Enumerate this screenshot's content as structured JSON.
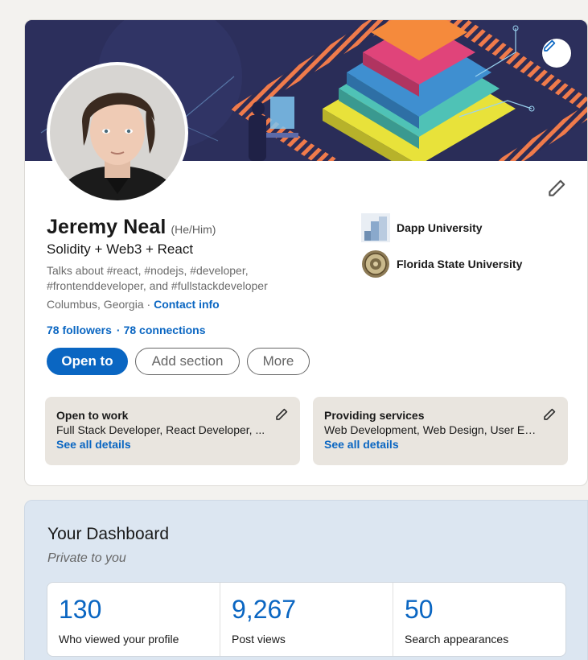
{
  "profile": {
    "name": "Jeremy Neal",
    "pronouns": "(He/Him)",
    "headline": "Solidity + Web3 + React",
    "talks_about": "Talks about #react, #nodejs, #developer, #frontenddeveloper, and #fullstackdeveloper",
    "location": "Columbus, Georgia",
    "location_separator": " · ",
    "contact_info": "Contact info",
    "followers": "78 followers",
    "connections": "78 connections",
    "connections_separator": "·"
  },
  "actions": {
    "open_to": "Open to",
    "add_section": "Add section",
    "more": "More"
  },
  "education": [
    {
      "name": "Dapp University",
      "icon": "dapp-university-logo"
    },
    {
      "name": "Florida State University",
      "icon": "fsu-seal-logo"
    }
  ],
  "info_boxes": [
    {
      "title": "Open to work",
      "subtitle": "Full Stack Developer, React Developer, ...",
      "link": "See all details"
    },
    {
      "title": "Providing services",
      "subtitle": "Web Development, Web Design, User Experience Design (UED)...",
      "link": "See all details"
    }
  ],
  "dashboard": {
    "title": "Your Dashboard",
    "subtitle": "Private to you",
    "stats": [
      {
        "value": "130",
        "label": "Who viewed your profile"
      },
      {
        "value": "9,267",
        "label": "Post views"
      },
      {
        "value": "50",
        "label": "Search appearances"
      }
    ]
  },
  "colors": {
    "brand_blue": "#0a66c2",
    "page_bg": "#f3f2ef",
    "dashboard_bg": "#dce6f1",
    "info_box_bg": "#e9e5df"
  }
}
